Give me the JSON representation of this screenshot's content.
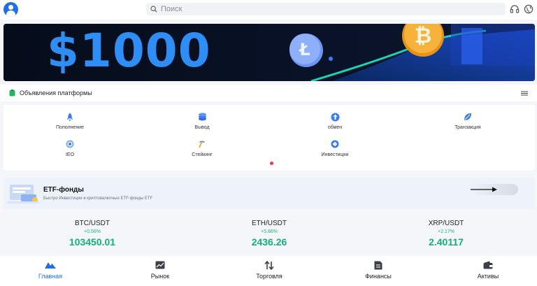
{
  "header": {
    "search_placeholder": "Поиск",
    "icons": [
      "avatar",
      "search-icon",
      "headset-icon",
      "globe-icon"
    ]
  },
  "banner": {
    "amount": "$1000"
  },
  "announcements": {
    "label": "Объявления платформы"
  },
  "quick_menu": {
    "items": [
      {
        "label": "Пополнение",
        "icon": "rocket-icon"
      },
      {
        "label": "Вывод",
        "icon": "coins-icon"
      },
      {
        "label": "обмен",
        "icon": "exchange-icon"
      },
      {
        "label": "Транзакция",
        "icon": "leaf-icon"
      },
      {
        "label": "IEO",
        "icon": "target-icon"
      },
      {
        "label": "Стейкинг",
        "icon": "pickaxe-icon"
      },
      {
        "label": "Инвестиции",
        "icon": "invest-icon"
      }
    ]
  },
  "etf": {
    "title": "ETF-фонды",
    "description": "Быстро Инвестиции в криптовалютные ETF-фонды ETF"
  },
  "tickers": [
    {
      "pair": "BTC/USDT",
      "change": "+0.56%",
      "price": "103450.01"
    },
    {
      "pair": "ETH/USDT",
      "change": "+5.86%",
      "price": "2436.26"
    },
    {
      "pair": "XRP/USDT",
      "change": "+2.17%",
      "price": "2.40117"
    }
  ],
  "bottom_nav": {
    "items": [
      {
        "label": "Главная",
        "icon": "home-mountain-icon",
        "active": true
      },
      {
        "label": "Рынок",
        "icon": "market-chart-icon",
        "active": false
      },
      {
        "label": "Торговля",
        "icon": "trade-arrows-icon",
        "active": false
      },
      {
        "label": "Финансы",
        "icon": "finance-doc-icon",
        "active": false
      },
      {
        "label": "Активы",
        "icon": "wallet-icon",
        "active": false
      }
    ]
  },
  "colors": {
    "accent": "#1f6fe8",
    "positive": "#14b07a",
    "banner_bg": "#081022",
    "banner_text": "#2f8ef5",
    "notice_dot": "#ef3b48"
  }
}
